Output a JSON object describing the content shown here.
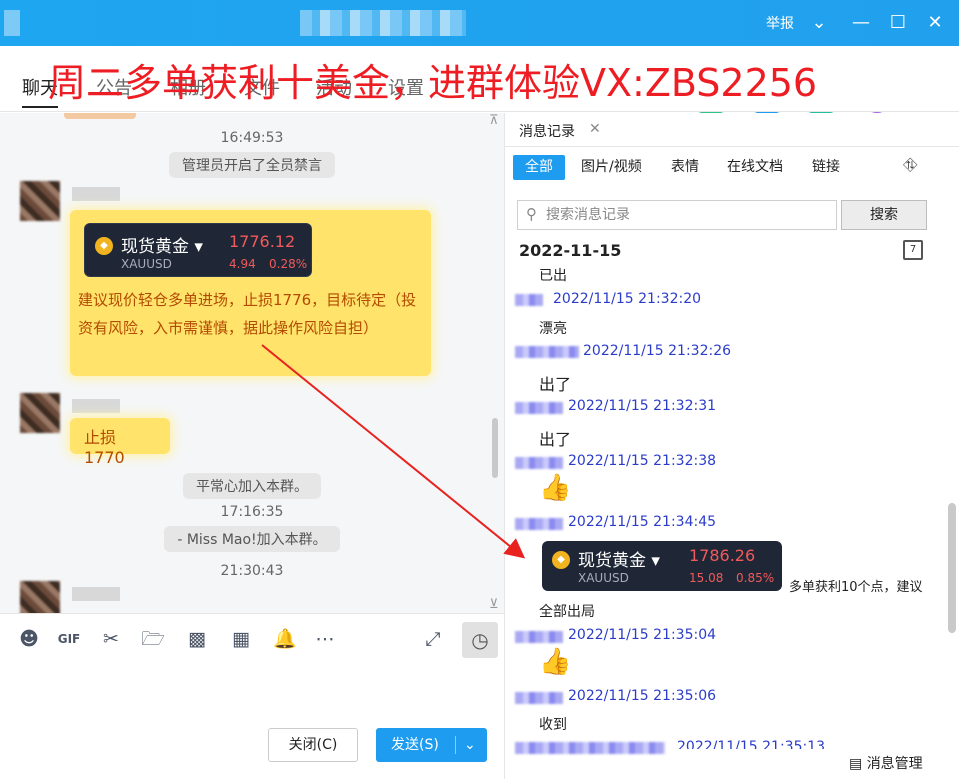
{
  "titlebar": {
    "report": "举报"
  },
  "banner": "周二多单获利十美金，进群体验VX:ZBS2256",
  "tabs": [
    {
      "label": "聊天"
    },
    {
      "label": "公告"
    },
    {
      "label": "相册"
    },
    {
      "label": "文件"
    },
    {
      "label": "活动"
    },
    {
      "label": "设置"
    }
  ],
  "chat": {
    "times": [
      "16:49:53",
      "17:16:35",
      "21:30:43"
    ],
    "system_msgs": [
      "管理员开启了全员禁言",
      "平常心加入本群。",
      "- Miss  Mao!加入本群。"
    ],
    "quote": {
      "name": "现货黄金",
      "symbol": "XAUUSD",
      "price": "1776.12",
      "change": "4.94",
      "pct": "0.28%"
    },
    "advice": "建议现价轻仓多单进场，止损1776，目标待定（投资有风险，入市需谨慎，据此操作风险自担）",
    "stop_loss": "止损1770"
  },
  "buttons": {
    "close": "关闭(C)",
    "send": "发送(S)"
  },
  "history": {
    "tab": "消息记录",
    "filters": [
      "全部",
      "图片/视频",
      "表情",
      "在线文档",
      "链接"
    ],
    "search_placeholder": "搜索消息记录",
    "search_btn": "搜索",
    "date": "2022-11-15",
    "cal_day": "7",
    "messages": [
      {
        "text": "已出",
        "meta": "2022/11/15 21:32:20"
      },
      {
        "text": "漂亮",
        "meta": "2022/11/15 21:32:26"
      },
      {
        "text": "出了",
        "meta": "2022/11/15 21:32:31"
      },
      {
        "text": "出了",
        "meta": "2022/11/15 21:32:38"
      },
      {
        "text": "",
        "meta": "2022/11/15 21:34:45"
      },
      {
        "text": "全部出局",
        "meta": "2022/11/15 21:35:04"
      },
      {
        "text": "",
        "meta": "2022/11/15 21:35:06"
      },
      {
        "text": "收到",
        "meta": "2022/11/15 21:35:13"
      }
    ],
    "quote": {
      "name": "现货黄金",
      "symbol": "XAUUSD",
      "price": "1786.26",
      "change": "15.08",
      "pct": "0.85%"
    },
    "quote_text": "多单获利10个点，建议",
    "manage": "消息管理"
  }
}
